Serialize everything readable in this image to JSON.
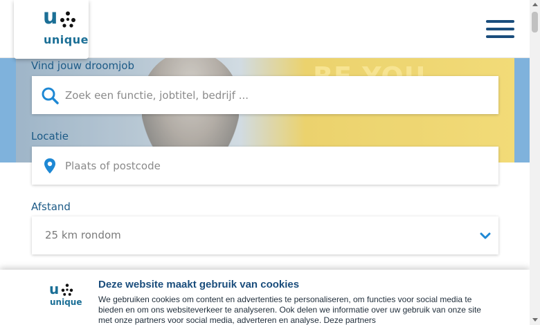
{
  "header": {
    "logo_letter": "u",
    "logo_word": "unique",
    "menu_icon": "hamburger-menu-icon"
  },
  "hero": {
    "banner_text": "BE YOU"
  },
  "form": {
    "job_label": "Vind jouw droomjob",
    "job_placeholder": "Zoek een functie, jobtitel, bedrijf ...",
    "job_icon": "search-icon",
    "location_label": "Locatie",
    "location_placeholder": "Plaats of postcode",
    "location_icon": "location-pin-icon",
    "distance_label": "Afstand",
    "distance_value": "25 km rondom",
    "distance_icon": "chevron-down-icon"
  },
  "cookie_banner": {
    "logo_letter": "u",
    "logo_word": "unique",
    "title": "Deze website maakt gebruik van cookies",
    "body": "We gebruiken cookies om content en advertenties te personaliseren, om functies voor social media te bieden en om ons websiteverkeer te analyseren. Ook delen we informatie over uw gebruik van onze site met onze partners voor social media, adverteren en analyse. Deze partners"
  },
  "colors": {
    "brand_blue": "#1b6f96",
    "label_blue": "#1c5a86",
    "nav_blue": "#1a4d7c",
    "icon_blue": "#1e88d4",
    "hero_blue": "#7fb2dc"
  }
}
